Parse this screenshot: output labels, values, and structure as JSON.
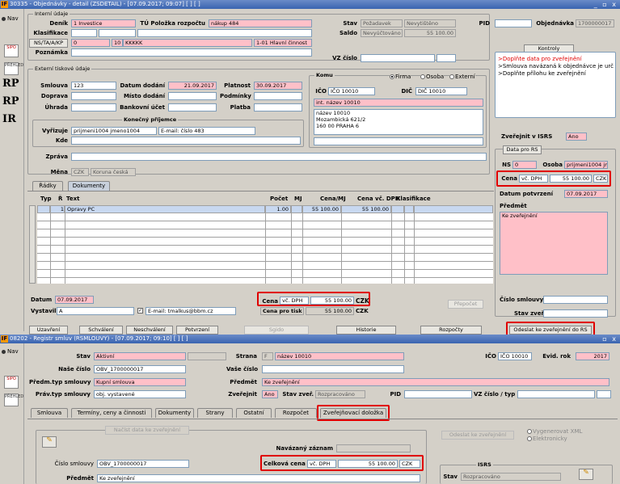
{
  "win1": {
    "title": "30335 - Objednávky - detail (ZSDETAIL) - [07.09.2017; 09:07]  [ ]  [ ]",
    "logo": "IF",
    "controls": "_ ▫ x"
  },
  "win2": {
    "title": "08202 - Registr smluv (RSMLOUVY) - [07.09.2017; 09:10]  [ ]  [ ]",
    "logo": "IF",
    "controls": "▫ x"
  },
  "left": {
    "nav": "Nav",
    "icons": [
      {
        "name": "sipo-icon",
        "text": "SIPO"
      },
      {
        "name": "prehled-icon",
        "text": "PŘEHLED"
      }
    ],
    "rp1": "RP",
    "rp2": "RP",
    "ir": "IR"
  },
  "top": {
    "interni_udaje": "Interní údaje",
    "denik_label": "Deník",
    "denik_val": "1 Investice",
    "tu_label": "TÚ Položka rozpočtu",
    "tu_val": "nákup 484",
    "klasifikace_label": "Klasifikace",
    "ns_label": "NS/TA/A/KP",
    "ns_val": "0",
    "ns_val2": "10",
    "ns_val3": "KKKKK",
    "ns_val4": "1-01 Hlavní činnost",
    "poznamka_label": "Poznámka",
    "stav_label": "Stav",
    "stav_val1": "Požadavek",
    "stav_val2": "Nevytištěno",
    "saldo_label": "Saldo",
    "saldo_val1": "Nevyúčtováno",
    "saldo_val2": "55 100.00",
    "pid_label": "PID",
    "obj_label": "Objednávka",
    "obj_val": "1700000017",
    "vz_label": "VZ číslo",
    "kontroly_btn": "Kontroly",
    "kontroly": [
      ">Doplňte data pro zveřejnění",
      ">Smlouva navázaná k objednávce je urče",
      ">Doplňte přílohu ke zveřejnění"
    ]
  },
  "ext": {
    "title": "Externí tiskové údaje",
    "smlouva_label": "Smlouva",
    "smlouva_val": "123",
    "datum_dodani_label": "Datum dodání",
    "datum_dodani_val": "21.09.2017",
    "platnost_label": "Platnost",
    "platnost_val": "30.09.2017",
    "doprava_label": "Doprava",
    "misto_label": "Místo dodání",
    "podminky_label": "Podmínky",
    "uhrada_label": "Úhrada",
    "bank_label": "Bankovní účet",
    "platba_label": "Platba",
    "kp_title": "Konečný příjemce",
    "vyrizuje_label": "Vyřizuje",
    "vyrizuje_val": "prijmeni1004 jmeno1004",
    "email_val": "E-mail: číslo 483",
    "kde_label": "Kde",
    "zprava_label": "Zpráva",
    "mena_label": "Měna",
    "mena_val": "CZK",
    "mena_val2": "Koruna česká"
  },
  "komu": {
    "title": "Komu",
    "firma": "Firma",
    "osoba": "Osoba",
    "externi": "Externí",
    "ico_label": "IČO",
    "ico_val": "IČO 10010",
    "dic_label": "DIČ",
    "dic_val": "DIČ 10010",
    "nazev": "int. název 10010",
    "addr": [
      "název 10010",
      "Mozambická 621/2",
      "160 00  PRAHA 6"
    ]
  },
  "isrs": {
    "zverejnit_label": "Zveřejnit v ISRS",
    "zverejnit_val": "Ano",
    "data_btn": "Data pro RS",
    "ns_label": "NS",
    "ns_val": "0",
    "osoba_label": "Osoba",
    "osoba_val": "prijmeni1004 jm",
    "cena_label": "Cena",
    "cena_type": "vč. DPH",
    "cena_val": "55 100.00",
    "cena_cur": "CZK",
    "datum_label": "Datum potvrzení",
    "datum_val": "07.09.2017",
    "predmet_label": "Předmět",
    "predmet_val": "Ke zveřejnění",
    "cislo_label": "Číslo smlouvy",
    "stav_label": "Stav zveř.",
    "odeslat_btn": "Odeslat ke zveřejnění do RS"
  },
  "tabs1": {
    "radky": "Řádky",
    "dokumenty": "Dokumenty"
  },
  "grid": {
    "headers": {
      "typ": "Typ",
      "r": "Ř",
      "text": "Text",
      "pocet": "Počet",
      "mj": "MJ",
      "cena_mj": "Cena/MJ",
      "cena_dph": "Cena vč. DPH",
      "klas": "Klasifikace"
    },
    "row1": {
      "r": "1",
      "text": "Opravy PC",
      "pocet": "1.00",
      "cena_mj": "55 100.00",
      "cena_dph": "55 100.00"
    }
  },
  "bottom": {
    "datum_label": "Datum",
    "datum_val": "07.09.2017",
    "vystavil_label": "Vystavil",
    "vystavil_val": "A",
    "email_val": "E-mail: tmalkus@bbm.cz",
    "cena_label": "Cena",
    "cena_type": "vč. DPH",
    "cena_val": "55 100.00",
    "cena_cur": "CZK",
    "cena_tisk_label": "Cena pro tisk",
    "cena_tisk_val": "55 100.00",
    "cena_tisk_cur": "CZK",
    "prepocet_btn": "Přepočet"
  },
  "buttons1": [
    "Uzavření",
    "Schválení",
    "Neschválení",
    "Potvrzení",
    "Sgido",
    "Historie",
    "Rozpočty"
  ],
  "w2": {
    "stav_label": "Stav",
    "stav_val": "Aktivní",
    "strana_label": "Strana",
    "strana_val": "F",
    "strana_name": "název 10010",
    "ico_label": "IČO",
    "ico_val": "IČO 10010",
    "evid_label": "Evid. rok",
    "evid_val": "2017",
    "nase_label": "Naše číslo",
    "nase_val": "OBV_1700000017",
    "vase_label": "Vaše číslo",
    "predm_typ_label": "Předm.typ smlouvy",
    "predm_typ_val": "Kupní smlouva",
    "predmet_label": "Předmět",
    "predmet_val": "Ke zveřejnění",
    "prav_typ_label": "Práv.typ smlouvy",
    "prav_typ_val": "obj. vystavené",
    "zverejnit_label": "Zveřejnit",
    "zverejnit_val": "Ano",
    "stav_zver_label": "Stav zveř.",
    "stav_zver_val": "Rozpracováno",
    "pid_label": "PID",
    "vz_label": "VZ číslo / typ",
    "tabs": [
      "Smlouva",
      "Termíny, ceny a činnosti",
      "Dokumenty",
      "Strany",
      "Ostatní",
      "Rozpočet",
      "Zveřejňovací doložka"
    ],
    "nacist_btn": "Načíst data ke zveřejnění",
    "navazany_label": "Navázaný záznam",
    "odeslat_btn": "Odeslat ke zveřejnění",
    "vygenerovat": "Vygenerovat XML",
    "elektronicky": "Elektronicky",
    "cislo_label": "Číslo smlouvy",
    "cislo_val": "OBV_1700000017",
    "celkova_label": "Celková cena",
    "celkova_type": "vč. DPH",
    "celkova_val": "55 100.00",
    "celkova_cur": "CZK",
    "isrs_title": "ISRS",
    "isrs_stav_label": "Stav",
    "isrs_stav_val": "Rozpracováno",
    "predmet2_label": "Předmět",
    "predmet2_val": "Ke zveřejnění"
  }
}
